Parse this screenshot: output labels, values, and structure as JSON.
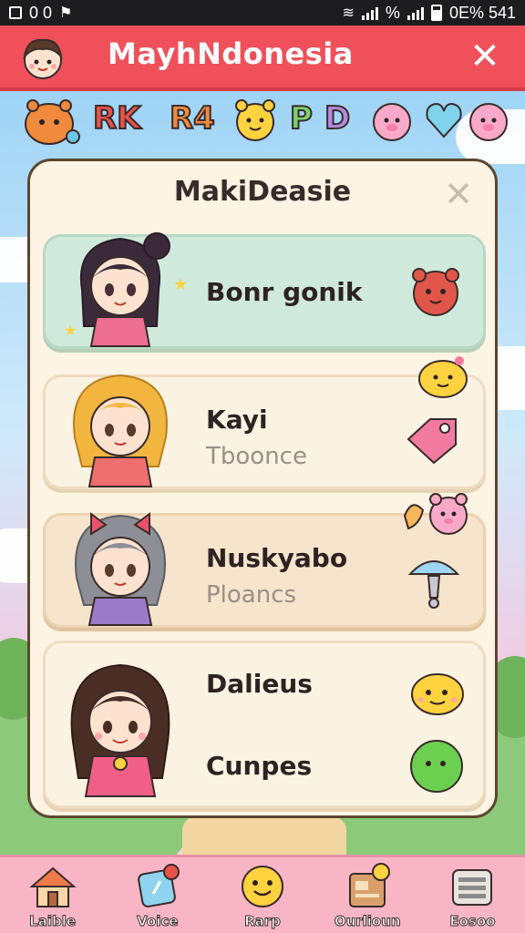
{
  "status_bar": {
    "left_text": "0 0",
    "right_text_1": "%",
    "right_text_2": "0E% 541"
  },
  "header": {
    "title": "MayhNdonesia",
    "close_icon": "close-icon"
  },
  "stickers": {
    "text_1": "RK",
    "text_2": "R4",
    "text_3": "P",
    "text_4": "D"
  },
  "panel": {
    "title": "MakiDeasie",
    "close_icon": "close-icon"
  },
  "cards": [
    {
      "name": "Bonr gonik",
      "subtitle": "",
      "icon": "bear-face-icon"
    },
    {
      "name": "Kayi",
      "subtitle": "Tboonce",
      "icon": "pink-tag-icon"
    },
    {
      "name": "Nuskyabo",
      "subtitle": "Ploancs",
      "icon": "ice-cream-icon"
    },
    {
      "name": "Dalieus",
      "subtitle": "Cunpes",
      "icon": "green-ball-icon"
    }
  ],
  "nav": [
    {
      "label": "Laible",
      "icon": "house-icon"
    },
    {
      "label": "Voice",
      "icon": "map-pin-icon"
    },
    {
      "label": "Rarp",
      "icon": "smiley-icon"
    },
    {
      "label": "Ourlioun",
      "icon": "notebook-icon"
    },
    {
      "label": "Eosoo",
      "icon": "stack-icon"
    }
  ],
  "colors": {
    "header": "#f0505a",
    "panel_bg": "#fdf4e3",
    "selected_card": "#cfeadc",
    "nav_bg": "#f8b5c6"
  }
}
